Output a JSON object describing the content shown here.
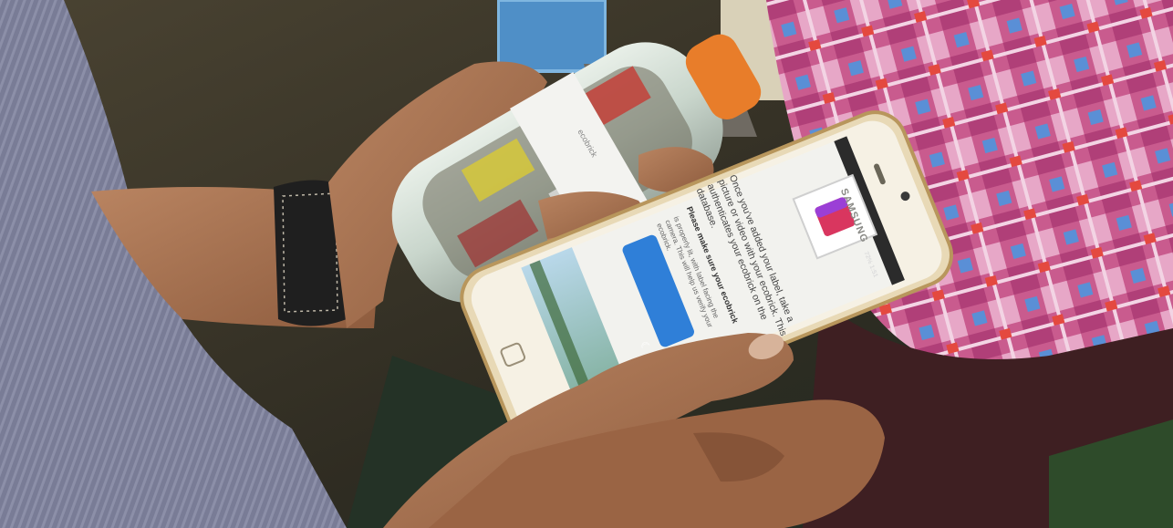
{
  "phone": {
    "brand": "SAMSUNG",
    "status_bar": "72% 1:51",
    "screen": {
      "instruction": "Once you've added your label, take a picture or video with your ecobrick. This authenticates your ecobrick on the database.",
      "note_title": "Please make sure your ecobrick",
      "note_body": "is properly lit, with label facing the camera. This will help us verify your ecobrick.",
      "button_label": "☾"
    }
  },
  "bottle_label": {
    "text": "ecobrick"
  },
  "colors": {
    "phone_frame": "#e8d9b6",
    "screen_bg": "#f2f2ee",
    "button": "#2f7fd8",
    "hands": "#a8714e"
  }
}
